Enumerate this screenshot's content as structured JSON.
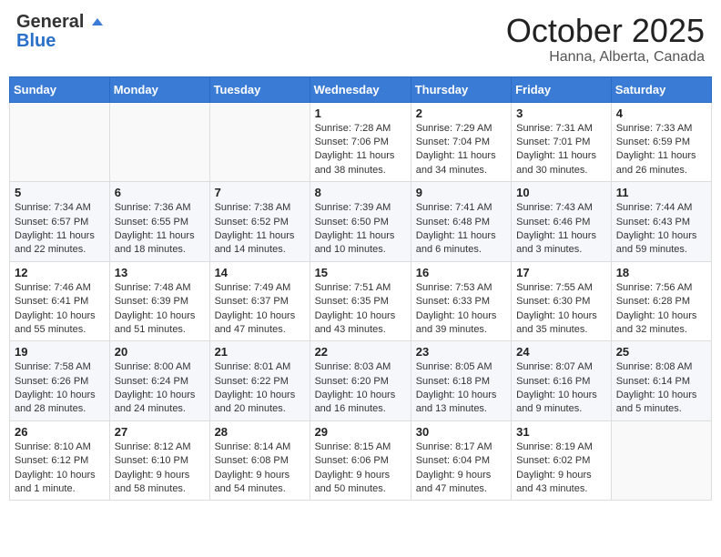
{
  "header": {
    "logo_general": "General",
    "logo_blue": "Blue",
    "month": "October 2025",
    "location": "Hanna, Alberta, Canada"
  },
  "weekdays": [
    "Sunday",
    "Monday",
    "Tuesday",
    "Wednesday",
    "Thursday",
    "Friday",
    "Saturday"
  ],
  "weeks": [
    [
      {
        "day": "",
        "info": ""
      },
      {
        "day": "",
        "info": ""
      },
      {
        "day": "",
        "info": ""
      },
      {
        "day": "1",
        "info": "Sunrise: 7:28 AM\nSunset: 7:06 PM\nDaylight: 11 hours\nand 38 minutes."
      },
      {
        "day": "2",
        "info": "Sunrise: 7:29 AM\nSunset: 7:04 PM\nDaylight: 11 hours\nand 34 minutes."
      },
      {
        "day": "3",
        "info": "Sunrise: 7:31 AM\nSunset: 7:01 PM\nDaylight: 11 hours\nand 30 minutes."
      },
      {
        "day": "4",
        "info": "Sunrise: 7:33 AM\nSunset: 6:59 PM\nDaylight: 11 hours\nand 26 minutes."
      }
    ],
    [
      {
        "day": "5",
        "info": "Sunrise: 7:34 AM\nSunset: 6:57 PM\nDaylight: 11 hours\nand 22 minutes."
      },
      {
        "day": "6",
        "info": "Sunrise: 7:36 AM\nSunset: 6:55 PM\nDaylight: 11 hours\nand 18 minutes."
      },
      {
        "day": "7",
        "info": "Sunrise: 7:38 AM\nSunset: 6:52 PM\nDaylight: 11 hours\nand 14 minutes."
      },
      {
        "day": "8",
        "info": "Sunrise: 7:39 AM\nSunset: 6:50 PM\nDaylight: 11 hours\nand 10 minutes."
      },
      {
        "day": "9",
        "info": "Sunrise: 7:41 AM\nSunset: 6:48 PM\nDaylight: 11 hours\nand 6 minutes."
      },
      {
        "day": "10",
        "info": "Sunrise: 7:43 AM\nSunset: 6:46 PM\nDaylight: 11 hours\nand 3 minutes."
      },
      {
        "day": "11",
        "info": "Sunrise: 7:44 AM\nSunset: 6:43 PM\nDaylight: 10 hours\nand 59 minutes."
      }
    ],
    [
      {
        "day": "12",
        "info": "Sunrise: 7:46 AM\nSunset: 6:41 PM\nDaylight: 10 hours\nand 55 minutes."
      },
      {
        "day": "13",
        "info": "Sunrise: 7:48 AM\nSunset: 6:39 PM\nDaylight: 10 hours\nand 51 minutes."
      },
      {
        "day": "14",
        "info": "Sunrise: 7:49 AM\nSunset: 6:37 PM\nDaylight: 10 hours\nand 47 minutes."
      },
      {
        "day": "15",
        "info": "Sunrise: 7:51 AM\nSunset: 6:35 PM\nDaylight: 10 hours\nand 43 minutes."
      },
      {
        "day": "16",
        "info": "Sunrise: 7:53 AM\nSunset: 6:33 PM\nDaylight: 10 hours\nand 39 minutes."
      },
      {
        "day": "17",
        "info": "Sunrise: 7:55 AM\nSunset: 6:30 PM\nDaylight: 10 hours\nand 35 minutes."
      },
      {
        "day": "18",
        "info": "Sunrise: 7:56 AM\nSunset: 6:28 PM\nDaylight: 10 hours\nand 32 minutes."
      }
    ],
    [
      {
        "day": "19",
        "info": "Sunrise: 7:58 AM\nSunset: 6:26 PM\nDaylight: 10 hours\nand 28 minutes."
      },
      {
        "day": "20",
        "info": "Sunrise: 8:00 AM\nSunset: 6:24 PM\nDaylight: 10 hours\nand 24 minutes."
      },
      {
        "day": "21",
        "info": "Sunrise: 8:01 AM\nSunset: 6:22 PM\nDaylight: 10 hours\nand 20 minutes."
      },
      {
        "day": "22",
        "info": "Sunrise: 8:03 AM\nSunset: 6:20 PM\nDaylight: 10 hours\nand 16 minutes."
      },
      {
        "day": "23",
        "info": "Sunrise: 8:05 AM\nSunset: 6:18 PM\nDaylight: 10 hours\nand 13 minutes."
      },
      {
        "day": "24",
        "info": "Sunrise: 8:07 AM\nSunset: 6:16 PM\nDaylight: 10 hours\nand 9 minutes."
      },
      {
        "day": "25",
        "info": "Sunrise: 8:08 AM\nSunset: 6:14 PM\nDaylight: 10 hours\nand 5 minutes."
      }
    ],
    [
      {
        "day": "26",
        "info": "Sunrise: 8:10 AM\nSunset: 6:12 PM\nDaylight: 10 hours\nand 1 minute."
      },
      {
        "day": "27",
        "info": "Sunrise: 8:12 AM\nSunset: 6:10 PM\nDaylight: 9 hours\nand 58 minutes."
      },
      {
        "day": "28",
        "info": "Sunrise: 8:14 AM\nSunset: 6:08 PM\nDaylight: 9 hours\nand 54 minutes."
      },
      {
        "day": "29",
        "info": "Sunrise: 8:15 AM\nSunset: 6:06 PM\nDaylight: 9 hours\nand 50 minutes."
      },
      {
        "day": "30",
        "info": "Sunrise: 8:17 AM\nSunset: 6:04 PM\nDaylight: 9 hours\nand 47 minutes."
      },
      {
        "day": "31",
        "info": "Sunrise: 8:19 AM\nSunset: 6:02 PM\nDaylight: 9 hours\nand 43 minutes."
      },
      {
        "day": "",
        "info": ""
      }
    ]
  ]
}
